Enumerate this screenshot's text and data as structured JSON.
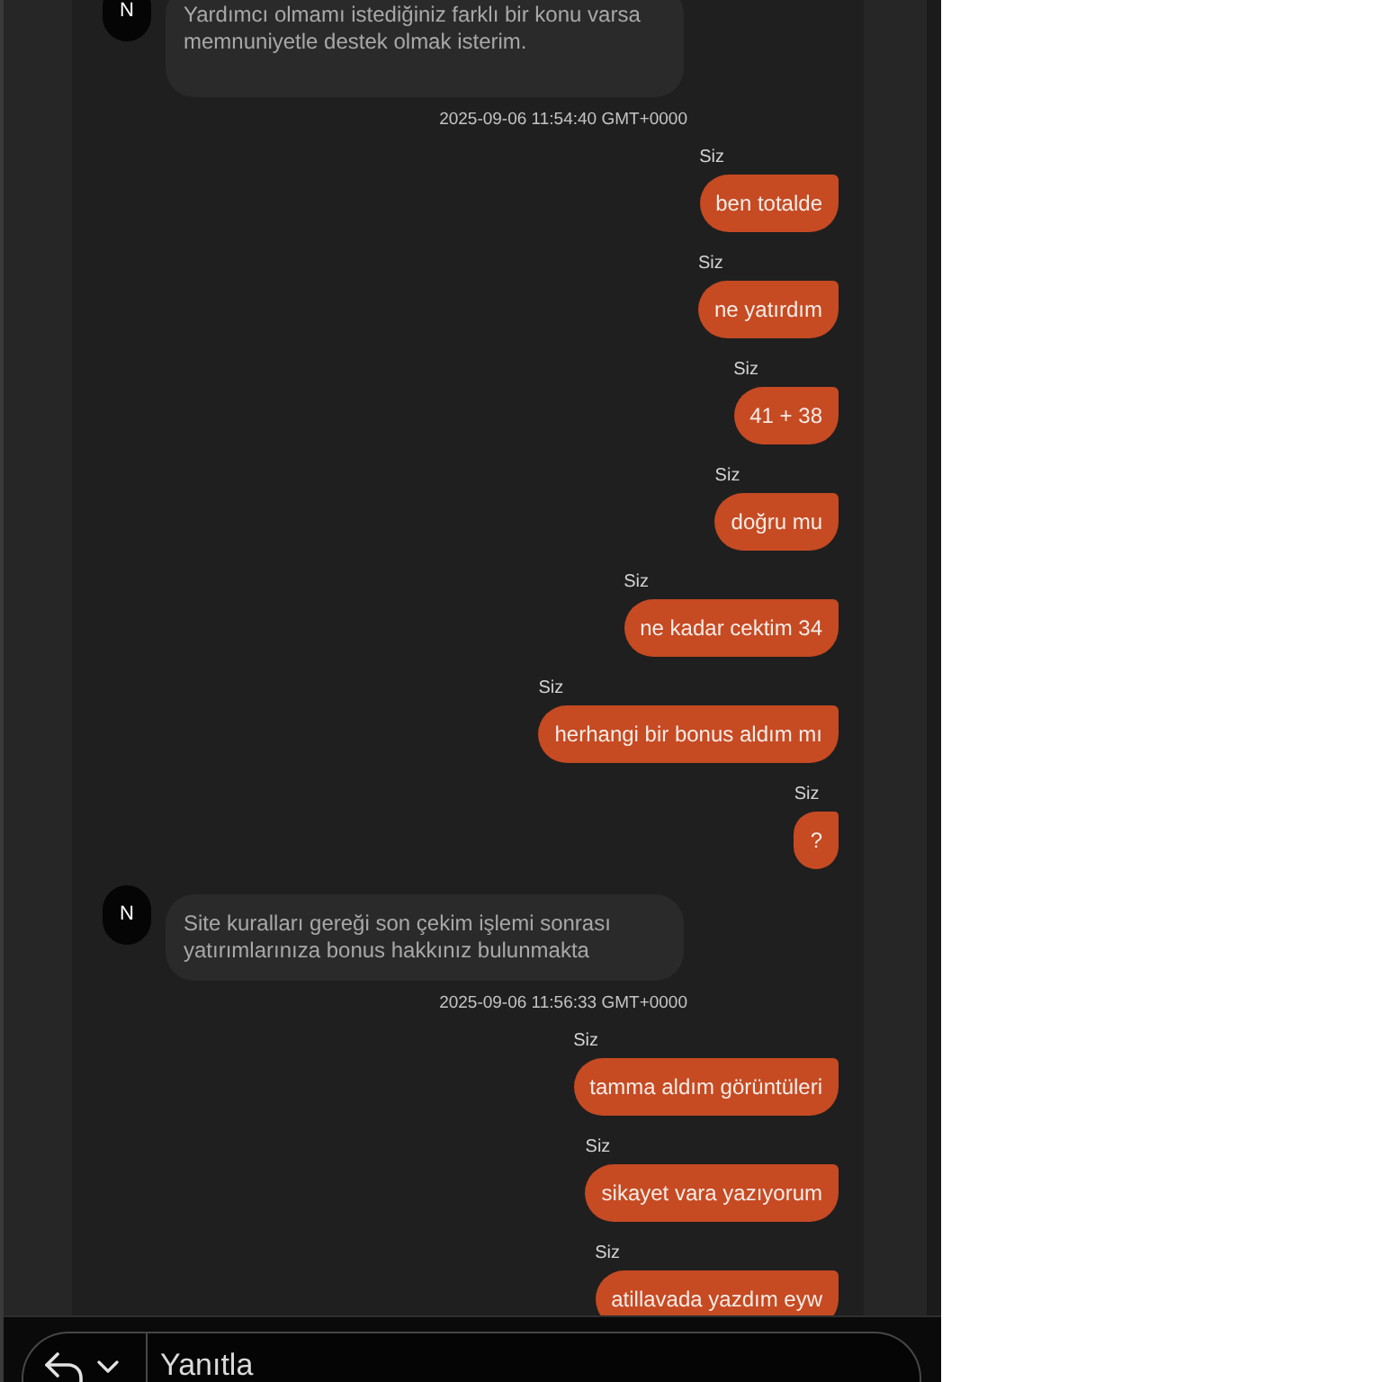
{
  "messages": [
    {
      "kind": "agent",
      "avatar": "N",
      "text": "Yardımcı olmamı istediğiniz farklı bir konu varsa memnuniyetle destek olmak isterim."
    },
    {
      "kind": "timestamp",
      "text": "2025-09-06 11:54:40 GMT+0000"
    },
    {
      "kind": "user",
      "sender": "Siz",
      "text": "ben totalde"
    },
    {
      "kind": "user",
      "sender": "Siz",
      "text": "ne yatırdım"
    },
    {
      "kind": "user",
      "sender": "Siz",
      "text": "41 + 38"
    },
    {
      "kind": "user",
      "sender": "Siz",
      "text": "doğru mu"
    },
    {
      "kind": "user",
      "sender": "Siz",
      "text": "ne kadar cektim 34"
    },
    {
      "kind": "user",
      "sender": "Siz",
      "text": "herhangi bir bonus aldım mı"
    },
    {
      "kind": "user",
      "sender": "Siz",
      "text": "?"
    },
    {
      "kind": "agent",
      "avatar": "N",
      "text": "Site kuralları gereği son çekim işlemi sonrası yatırımlarınıza bonus hakkınız bulunmakta"
    },
    {
      "kind": "timestamp",
      "text": "2025-09-06 11:56:33 GMT+0000"
    },
    {
      "kind": "user",
      "sender": "Siz",
      "text": "tamma aldım görüntüleri"
    },
    {
      "kind": "user",
      "sender": "Siz",
      "text": "sikayet vara yazıyorum"
    },
    {
      "kind": "user",
      "sender": "Siz",
      "text": "atillavada yazdım eyw"
    }
  ],
  "composer": {
    "placeholder": "Yanıtla"
  }
}
